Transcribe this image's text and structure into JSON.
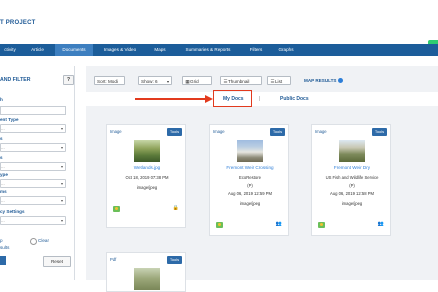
{
  "header": {
    "project_title": "T PROJECT"
  },
  "nav": {
    "items": [
      {
        "label": "ctivity"
      },
      {
        "label": "Article"
      },
      {
        "label": "Documents"
      },
      {
        "label": "Images & Video"
      },
      {
        "label": "Maps"
      },
      {
        "label": "Summaries & Reports"
      },
      {
        "label": "Filters"
      },
      {
        "label": "Graphs"
      }
    ]
  },
  "sidebar": {
    "title": "AND FILTER",
    "help_label": "?",
    "search_label": "h",
    "fields": [
      {
        "label": "ent Type",
        "value": "..."
      },
      {
        "label": "s",
        "value": "..."
      },
      {
        "label": "s",
        "value": "..."
      },
      {
        "label": "ype",
        "value": "..."
      },
      {
        "label": "ms",
        "value": "..."
      },
      {
        "label": "cy Settings",
        "value": "..."
      }
    ],
    "map_label": "p",
    "results_label": "sults",
    "clear_label": "Clear",
    "reset_label": "Reset"
  },
  "toolbar": {
    "sort_label": "Sort: Modi",
    "show_label": "Show: 6",
    "grid_label": "Grid",
    "thumbnail_label": "Thumbnail",
    "list_label": "List",
    "map_results_label": "MAP RESULTS"
  },
  "tabs": {
    "my_docs": "My Docs",
    "separator": "|",
    "public_docs": "Public Docs"
  },
  "cards": [
    {
      "type": "Image",
      "tools": "Tools",
      "title": "Wetlands.jpg",
      "lines": [
        "Oct 18, 2019 07:38 PM",
        "image/jpeg"
      ],
      "right_icon": "lock-icon"
    },
    {
      "type": "Image",
      "tools": "Tools",
      "title": "Fremont Weir Crossing",
      "lines": [
        "EcoRestore",
        "(P)",
        "Aug 06, 2019 12:59 PM",
        "image/jpeg"
      ],
      "right_icon": "group-icon"
    },
    {
      "type": "Image",
      "tools": "Tools",
      "title": "Fremont Weir Dry",
      "lines": [
        "US Fish and Wildlife Service",
        "(P)",
        "Aug 06, 2019 12:58 PM",
        "image/jpeg"
      ],
      "right_icon": "group-icon"
    },
    {
      "type": "Pdf",
      "tools": "Tools",
      "title": "",
      "lines": []
    }
  ],
  "colors": {
    "nav_bg": "#1c5d9a",
    "accent": "#2d6aa8",
    "highlight": "#e23a1e"
  }
}
